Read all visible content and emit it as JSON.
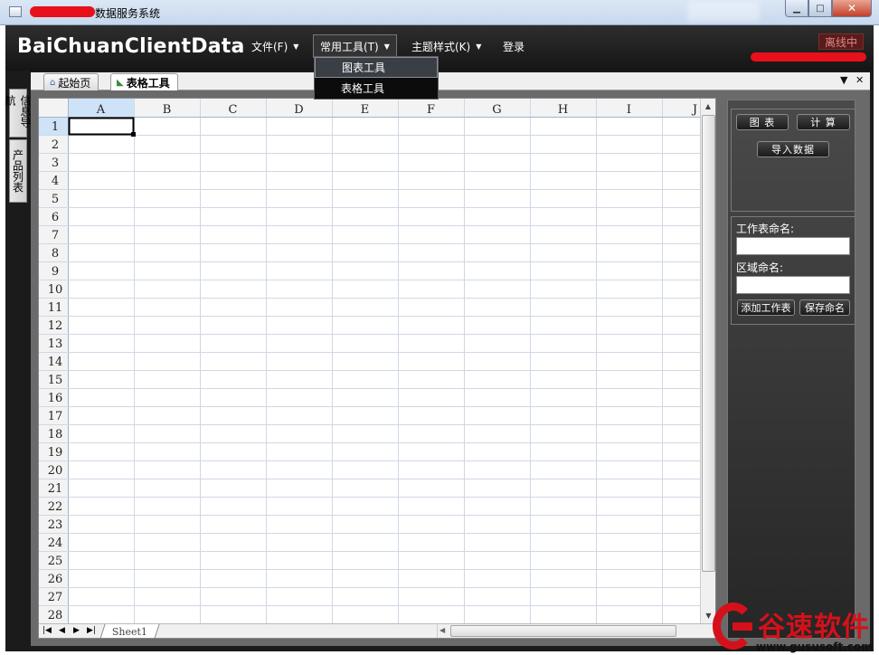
{
  "window": {
    "title": "数据服务系统",
    "minimize_glyph": "▁",
    "maximize_glyph": "□",
    "close_glyph": "✕"
  },
  "menubar": {
    "brand": "BaiChuanClientData",
    "menus": [
      {
        "label": "文件(F)",
        "caret": "▼"
      },
      {
        "label": "常用工具(T)",
        "caret": "▼"
      },
      {
        "label": "主题样式(K)",
        "caret": "▼"
      },
      {
        "label": "登录",
        "caret": ""
      }
    ],
    "status": "离线中"
  },
  "dropdown": {
    "items": [
      "图表工具",
      "表格工具"
    ]
  },
  "left_tabs": [
    "信息导航",
    "产品列表"
  ],
  "doc_tabs": [
    {
      "label": "起始页",
      "icon": "home-icon",
      "glyph": "⌂"
    },
    {
      "label": "表格工具",
      "icon": "grid-icon",
      "glyph": "◣"
    }
  ],
  "strip_controls": {
    "dropdown_glyph": "▼",
    "close_glyph": "✕"
  },
  "spreadsheet": {
    "columns": [
      "A",
      "B",
      "C",
      "D",
      "E",
      "F",
      "G",
      "H",
      "I",
      "J"
    ],
    "rows": [
      "1",
      "2",
      "3",
      "4",
      "5",
      "6",
      "7",
      "8",
      "9",
      "10",
      "11",
      "12",
      "13",
      "14",
      "15",
      "16",
      "17",
      "18",
      "19",
      "20",
      "21",
      "22",
      "23",
      "24",
      "25",
      "26",
      "27",
      "28"
    ],
    "selected_cell": "A1",
    "sheet_tab": "Sheet1",
    "nav": [
      "|◀",
      "◀",
      "▶",
      "▶|"
    ]
  },
  "panel": {
    "chart_button": "图 表",
    "calc_button": "计 算",
    "import_button": "导入数据",
    "sheet_name_label": "工作表命名:",
    "sheet_name_value": "",
    "range_name_label": "区域命名:",
    "range_name_value": "",
    "add_sheet_button": "添加工作表",
    "save_name_button": "保存命名"
  },
  "watermark": {
    "text": "谷速软件",
    "url": "www.gususoft.com",
    "color": "#d4111a"
  }
}
